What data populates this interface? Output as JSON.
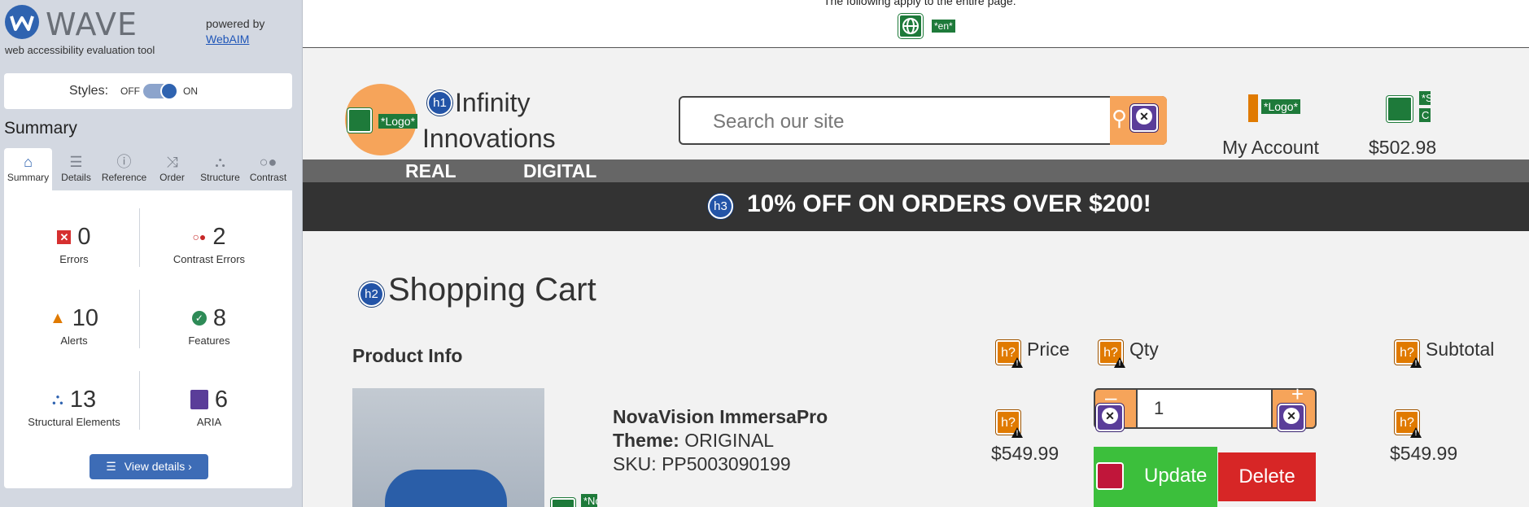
{
  "wave": {
    "logo_text": "WAVE",
    "tagline": "web accessibility evaluation tool",
    "powered_by": "powered by",
    "powered_link": "WebAIM",
    "styles_label": "Styles:",
    "styles_off": "OFF",
    "styles_on": "ON",
    "summary_heading": "Summary",
    "tabs": [
      {
        "label": "Summary",
        "icon": "home-icon"
      },
      {
        "label": "Details",
        "icon": "list-icon"
      },
      {
        "label": "Reference",
        "icon": "info-icon"
      },
      {
        "label": "Order",
        "icon": "order-icon"
      },
      {
        "label": "Structure",
        "icon": "structure-icon"
      },
      {
        "label": "Contrast",
        "icon": "contrast-icon"
      }
    ],
    "stats": {
      "errors": {
        "count": "0",
        "label": "Errors"
      },
      "contrast_errors": {
        "count": "2",
        "label": "Contrast Errors"
      },
      "alerts": {
        "count": "10",
        "label": "Alerts"
      },
      "features": {
        "count": "8",
        "label": "Features"
      },
      "structural": {
        "count": "13",
        "label": "Structural Elements"
      },
      "aria": {
        "count": "6",
        "label": "ARIA"
      }
    },
    "view_details": "View details ›",
    "colors": {
      "brand": "#2f63b0",
      "panel": "#d3d8e1"
    }
  },
  "page": {
    "notice_text": "The following apply to the entire page:",
    "lang_tag": "*en*",
    "logo_tag": "*Logo*",
    "h1": "h1",
    "brand_name": "Infinity Innovations",
    "search_placeholder": "Search our site",
    "account_logo_tag": "*Logo*",
    "cart_tag_1": "*S",
    "cart_tag_2": "C",
    "account_label": "My Account",
    "cart_total": "$502.98",
    "nav": [
      "REAL",
      "DIGITAL"
    ],
    "h3": "h3",
    "promo": "10% OFF ON ORDERS OVER $200!",
    "h2": "h2",
    "cart_title": "Shopping Cart",
    "col_product": "Product Info",
    "col_price": "Price",
    "col_qty": "Qty",
    "col_subtotal": "Subtotal",
    "h_q": "h?",
    "product": {
      "name": "NovaVision ImmersaPro",
      "theme_label": "Theme:",
      "theme_value": "ORIGINAL",
      "sku": "SKU: PP5003090199",
      "price": "$549.99",
      "qty": "1",
      "subtotal": "$549.99",
      "img_tag": "*No"
    },
    "update_label": "Update",
    "delete_label": "Delete",
    "colors": {
      "orange": "#f6a45a",
      "green": "#3cbf3c",
      "red": "#d72626",
      "dark": "#333333"
    }
  }
}
